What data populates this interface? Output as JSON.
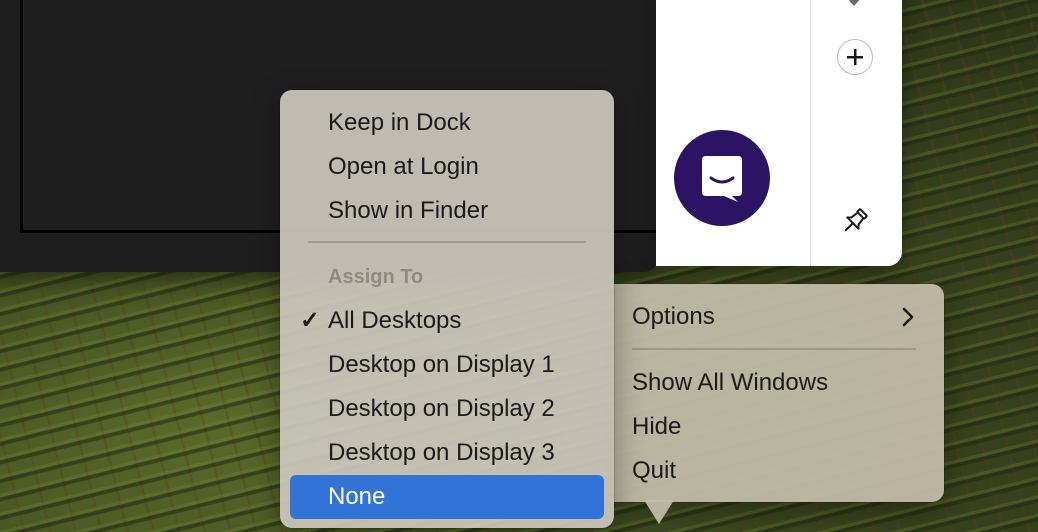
{
  "app_menu": {
    "items": [
      {
        "label": "Keep in Dock"
      },
      {
        "label": "Open at Login"
      },
      {
        "label": "Show in Finder"
      }
    ],
    "assign_heading": "Assign To",
    "checkmark": "✓",
    "assign_items": [
      {
        "label": "All Desktops",
        "checked": true
      },
      {
        "label": "Desktop on Display 1",
        "checked": false
      },
      {
        "label": "Desktop on Display 2",
        "checked": false
      },
      {
        "label": "Desktop on Display 3",
        "checked": false
      },
      {
        "label": "None",
        "checked": false,
        "highlighted": true
      }
    ]
  },
  "options_menu": {
    "options_label": "Options",
    "items": [
      {
        "label": "Show All Windows"
      },
      {
        "label": "Hide"
      },
      {
        "label": "Quit"
      }
    ]
  },
  "side_panel": {
    "icons": [
      "chevron-down-icon",
      "add-icon",
      "chat-icon",
      "pin-icon"
    ]
  },
  "colors": {
    "highlight": "#3173d6",
    "chat_button": "#2b1463",
    "dark_window": "#1e1e1e",
    "menu_bg": "#cdc9be"
  }
}
